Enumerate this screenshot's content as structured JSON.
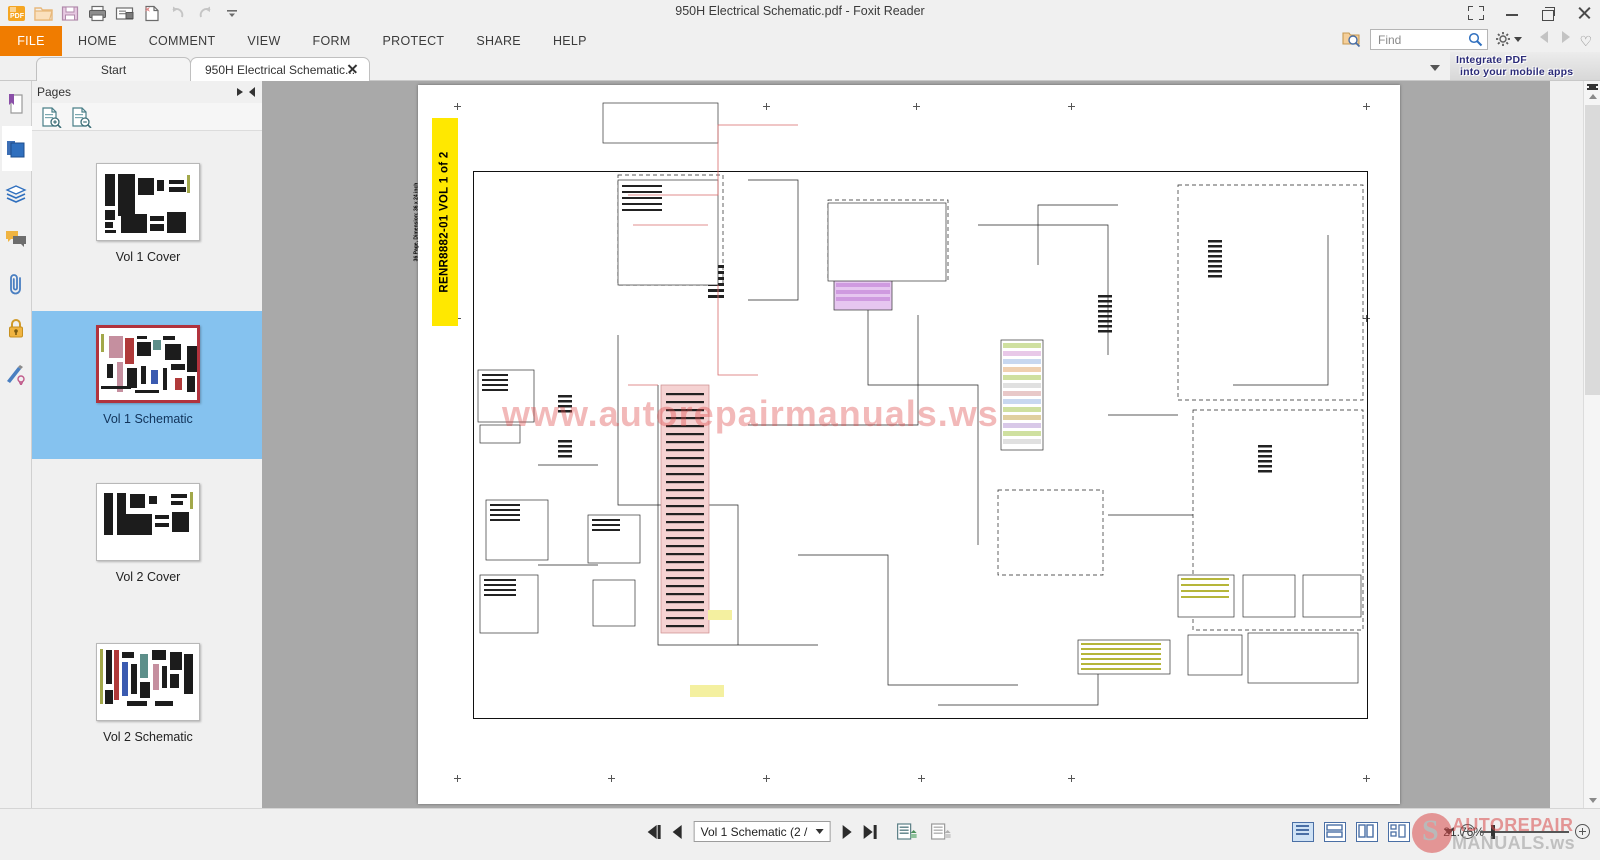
{
  "window": {
    "title": "950H Electrical Schematic.pdf - Foxit Reader",
    "controls": {
      "expand": "expand-restore",
      "minimize": "minimize",
      "maximize": "maximize",
      "close": "close"
    }
  },
  "quick_access": {
    "items": [
      {
        "name": "foxit-logo-icon",
        "label": "PDF"
      },
      {
        "name": "open-icon",
        "label": "Open"
      },
      {
        "name": "save-icon",
        "label": "Save"
      },
      {
        "name": "print-icon",
        "label": "Print"
      },
      {
        "name": "email-icon",
        "label": "Email"
      },
      {
        "name": "create-pdf-icon",
        "label": "Create PDF"
      },
      {
        "name": "undo-icon",
        "label": "Undo"
      },
      {
        "name": "redo-icon",
        "label": "Redo"
      },
      {
        "name": "customize-toolbar-icon",
        "label": "Customize"
      }
    ]
  },
  "ribbon": {
    "tabs": [
      {
        "label": "FILE",
        "active": true
      },
      {
        "label": "HOME",
        "active": false
      },
      {
        "label": "COMMENT",
        "active": false
      },
      {
        "label": "VIEW",
        "active": false
      },
      {
        "label": "FORM",
        "active": false
      },
      {
        "label": "PROTECT",
        "active": false
      },
      {
        "label": "SHARE",
        "active": false
      },
      {
        "label": "HELP",
        "active": false
      }
    ],
    "accent_color": "#f07c00"
  },
  "search": {
    "placeholder": "Find",
    "value": "",
    "icon": "search-icon",
    "advanced_search_icon": "advanced-search-icon"
  },
  "right_tools": {
    "settings_icon": "gear-icon",
    "settings_caret": "chevron-down-icon",
    "prev_icon": "chevron-left-icon",
    "next_icon": "chevron-right-icon",
    "favorite_icon": "heart-icon"
  },
  "banner": {
    "line1": "Integrate PDF",
    "line2": "into your mobile apps"
  },
  "tabs": [
    {
      "label": "Start",
      "closable": false,
      "active": false
    },
    {
      "label": "950H Electrical Schematic...",
      "closable": true,
      "active": true
    }
  ],
  "left_rail": {
    "items": [
      {
        "name": "bookmarks-icon",
        "label": "Bookmarks",
        "active": false
      },
      {
        "name": "pages-icon",
        "label": "Pages",
        "active": true
      },
      {
        "name": "layers-icon",
        "label": "Layers",
        "active": false
      },
      {
        "name": "comments-icon",
        "label": "Comments",
        "active": false
      },
      {
        "name": "attachments-icon",
        "label": "Attachments",
        "active": false
      },
      {
        "name": "security-icon",
        "label": "Security",
        "active": false
      },
      {
        "name": "signatures-icon",
        "label": "Digital Signatures",
        "active": false
      }
    ]
  },
  "pages_panel": {
    "title": "Pages",
    "collapse_icon": "double-arrow-right-icon",
    "expand_icon": "arrow-left-icon",
    "toolbar": [
      {
        "name": "enlarge-thumbnails-icon",
        "label": "Enlarge Page Thumbnails"
      },
      {
        "name": "reduce-thumbnails-icon",
        "label": "Reduce Page Thumbnails"
      }
    ],
    "thumbnails": [
      {
        "label": "Vol 1 Cover",
        "selected": false
      },
      {
        "label": "Vol 1 Schematic",
        "selected": true
      },
      {
        "label": "Vol 2 Cover",
        "selected": false
      },
      {
        "label": "Vol 2 Schematic",
        "selected": false
      }
    ]
  },
  "document": {
    "tag_title": "RENR8882-01 VOL 1 of 2",
    "tag_subtitle": "36 Page, Dimension: 36 x 24 inch",
    "tag_color": "#ffe800",
    "watermark": "www.autorepairmanuals.ws",
    "watermark_color": "#de4646"
  },
  "status_bar": {
    "first_page_label": "First Page",
    "prev_page_label": "Previous Page",
    "page_indicator": "Vol 1 Schematic (2 /",
    "next_page_label": "Next Page",
    "last_page_label": "Last Page",
    "tool_icons": [
      {
        "name": "page-transition-icon",
        "label": "Page Transition"
      },
      {
        "name": "rotate-view-icon",
        "label": "Rotate View"
      }
    ],
    "view_modes": [
      {
        "name": "single-page-view-icon",
        "label": "Single Page",
        "active": true
      },
      {
        "name": "continuous-view-icon",
        "label": "Continuous",
        "active": false
      },
      {
        "name": "facing-view-icon",
        "label": "Facing",
        "active": false
      },
      {
        "name": "continuous-facing-view-icon",
        "label": "Continuous Facing",
        "active": false
      }
    ],
    "zoom_level": "21.76%",
    "zoom_out_label": "Zoom Out",
    "zoom_in_label": "Zoom In"
  },
  "watermark_logo": {
    "line1": "AUTOREPAIR",
    "line2": "MANUALS.ws"
  }
}
